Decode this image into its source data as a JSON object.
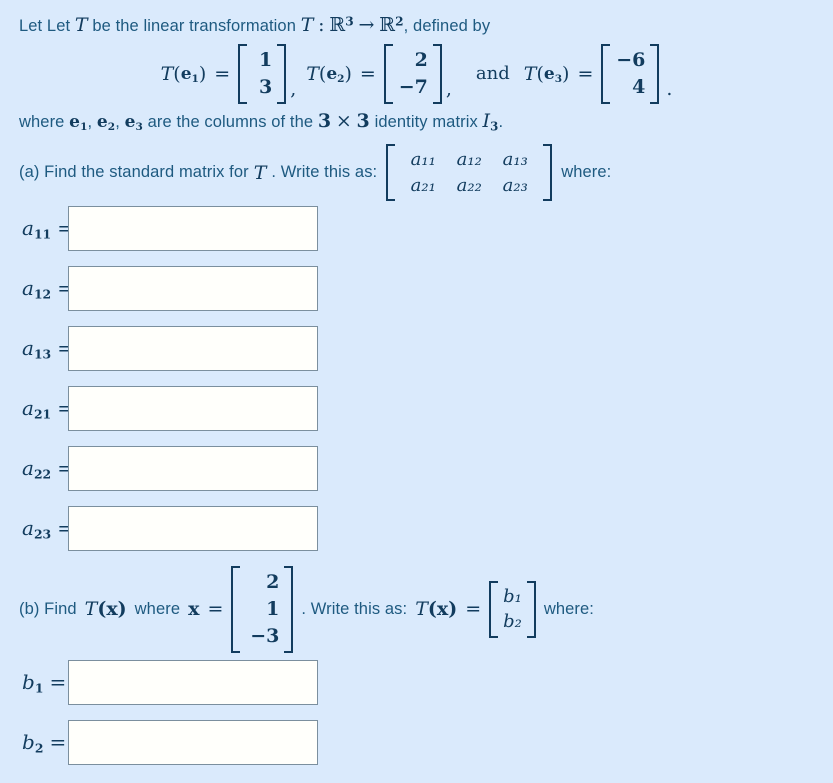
{
  "problem": {
    "intro_prefix": "Let Let",
    "intro_var": "T",
    "intro_mid": "be the linear transformation",
    "map_symbol": "T",
    "map_colon": ":",
    "domain": "R",
    "domain_exp": "3",
    "arrow": "→",
    "codomain": "R",
    "codomain_exp": "2",
    "intro_suffix": ", defined by"
  },
  "equations": {
    "t1": {
      "fn": "T",
      "arg": "e",
      "arg_sub": "1",
      "equals": "=",
      "values": [
        "1",
        "3"
      ]
    },
    "t2": {
      "fn": "T",
      "arg": "e",
      "arg_sub": "2",
      "equals": "=",
      "values": [
        "2",
        "−7"
      ]
    },
    "t3": {
      "fn": "T",
      "arg": "e",
      "arg_sub": "3",
      "equals": "=",
      "values": [
        "−6",
        "4"
      ]
    },
    "comma": ",",
    "and": "and",
    "period": "."
  },
  "where_line": {
    "where": "where",
    "e1": "e",
    "e1_sub": "1",
    "sep1": ",",
    "e2": "e",
    "e2_sub": "2",
    "sep2": ",",
    "e3": "e",
    "e3_sub": "3",
    "mid": "are the columns of the",
    "dim1": "3",
    "times": "×",
    "dim2": "3",
    "tail": "identity matrix",
    "identity": "I",
    "identity_sub": "3",
    "end": "."
  },
  "part_a": {
    "prompt_pre": "(a) Find the standard matrix for",
    "prompt_var": "T",
    "prompt_post": ". Write this as:",
    "matrix": [
      [
        "a₁₁",
        "a₁₂",
        "a₁₃"
      ],
      [
        "a₂₁",
        "a₂₂",
        "a₂₃"
      ]
    ],
    "where": "where:",
    "fields": [
      {
        "name": "a11",
        "base": "a",
        "sub": "11",
        "equals": "=",
        "value": "",
        "placeholder": ""
      },
      {
        "name": "a12",
        "base": "a",
        "sub": "12",
        "equals": "=",
        "value": "",
        "placeholder": ""
      },
      {
        "name": "a13",
        "base": "a",
        "sub": "13",
        "equals": "=",
        "value": "",
        "placeholder": ""
      },
      {
        "name": "a21",
        "base": "a",
        "sub": "21",
        "equals": "=",
        "value": "",
        "placeholder": ""
      },
      {
        "name": "a22",
        "base": "a",
        "sub": "22",
        "equals": "=",
        "value": "",
        "placeholder": ""
      },
      {
        "name": "a23",
        "base": "a",
        "sub": "23",
        "equals": "=",
        "value": "",
        "placeholder": ""
      }
    ]
  },
  "part_b": {
    "prompt_pre": "(b) Find",
    "prompt_fn": "T",
    "prompt_fn_arg": "(x)",
    "prompt_where": "where",
    "prompt_x": "x",
    "equals": "=",
    "x_vector": [
      "2",
      "1",
      "−3"
    ],
    "write_as": ". Write this as:",
    "tx_fn": "T",
    "tx_arg": "(x)",
    "tx_equals": "=",
    "b_vector": [
      "b₁",
      "b₂"
    ],
    "where": "where:",
    "fields": [
      {
        "name": "b1",
        "base": "b",
        "sub": "1",
        "equals": "=",
        "value": "",
        "placeholder": ""
      },
      {
        "name": "b2",
        "base": "b",
        "sub": "2",
        "equals": "=",
        "value": "",
        "placeholder": ""
      }
    ]
  },
  "colors": {
    "background": "#daeafc",
    "text": "#1e5a80",
    "math": "#123c5e",
    "field_border": "#7b8f9e",
    "field_background": "#fffffb"
  }
}
